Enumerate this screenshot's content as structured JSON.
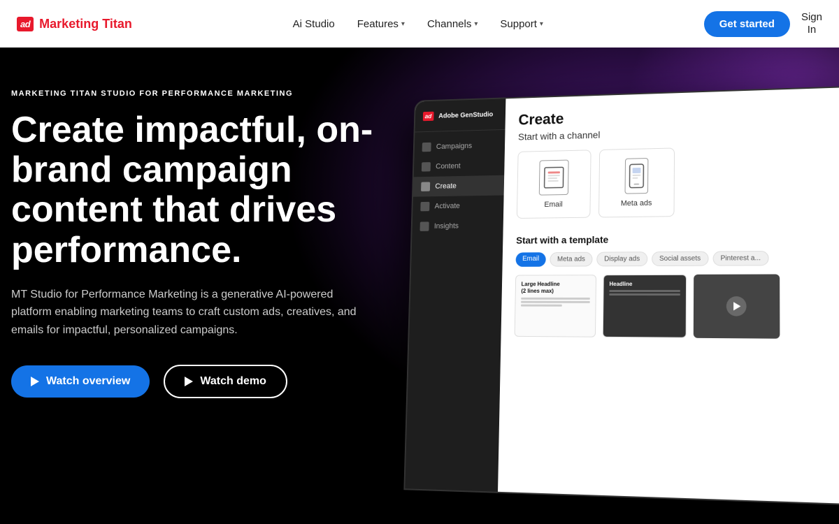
{
  "brand": {
    "logo_text": "ad",
    "name": "Marketing Titan",
    "color": "#e8192c"
  },
  "navbar": {
    "ai_studio": "Ai Studio",
    "features": "Features",
    "channels": "Channels",
    "support": "Support",
    "get_started": "Get started",
    "sign_in": "Sign\nIn"
  },
  "hero": {
    "eyebrow": "MARKETING TITAN STUDIO FOR PERFORMANCE MARKETING",
    "headline": "Create impactful, on-brand campaign content that drives performance.",
    "body": "MT Studio for Performance Marketing is a generative AI-powered platform enabling marketing teams to craft custom ads, creatives, and emails for impactful, personalized campaigns.",
    "watch_overview": "Watch overview",
    "watch_demo": "Watch demo"
  },
  "mockup": {
    "app_name": "Adobe GenStudio",
    "nav": [
      {
        "label": "Campaigns"
      },
      {
        "label": "Content"
      },
      {
        "label": "Create"
      },
      {
        "label": "Activate"
      },
      {
        "label": "Insights"
      }
    ],
    "page_title": "Create",
    "start_channel": "Start with a channel",
    "channels": [
      {
        "label": "Email"
      },
      {
        "label": "Meta ads"
      }
    ],
    "start_template": "Start with a template",
    "tabs": [
      "Email",
      "Meta ads",
      "Display ads",
      "Social assets",
      "Pinterest a..."
    ],
    "template_headline": "Large Headline\n(2 lines max)"
  }
}
